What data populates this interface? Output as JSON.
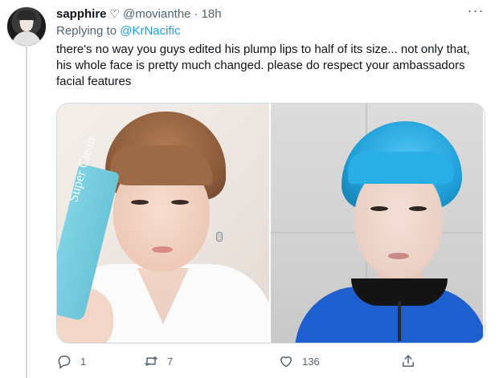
{
  "tweet": {
    "display_name": "sapphire",
    "name_emoji": "♡",
    "handle": "@movianthe",
    "separator": "·",
    "time": "18h",
    "more_label": "···",
    "replying_prefix": "Replying to",
    "replying_to": "@KrNacific",
    "text": "there's no way you guys edited his plump lips to half of its size... not only that, his whole face is pretty much changed. please do respect your ambassadors facial features"
  },
  "media": {
    "left_photo_text": "Super Clean",
    "images": [
      {
        "name": "left-photo",
        "description": "brown-haired man holding Super Clean tube"
      },
      {
        "name": "right-photo",
        "description": "blue-haired man selfie"
      }
    ]
  },
  "actions": {
    "reply_icon": "reply-icon",
    "reply_count": "1",
    "retweet_icon": "retweet-icon",
    "retweet_count": "7",
    "like_icon": "heart-icon",
    "like_count": "136",
    "share_icon": "share-icon"
  },
  "colors": {
    "link": "#1d9bf0",
    "secondary_text": "#536471",
    "primary_text": "#0f1419",
    "border": "#cfd9de"
  }
}
